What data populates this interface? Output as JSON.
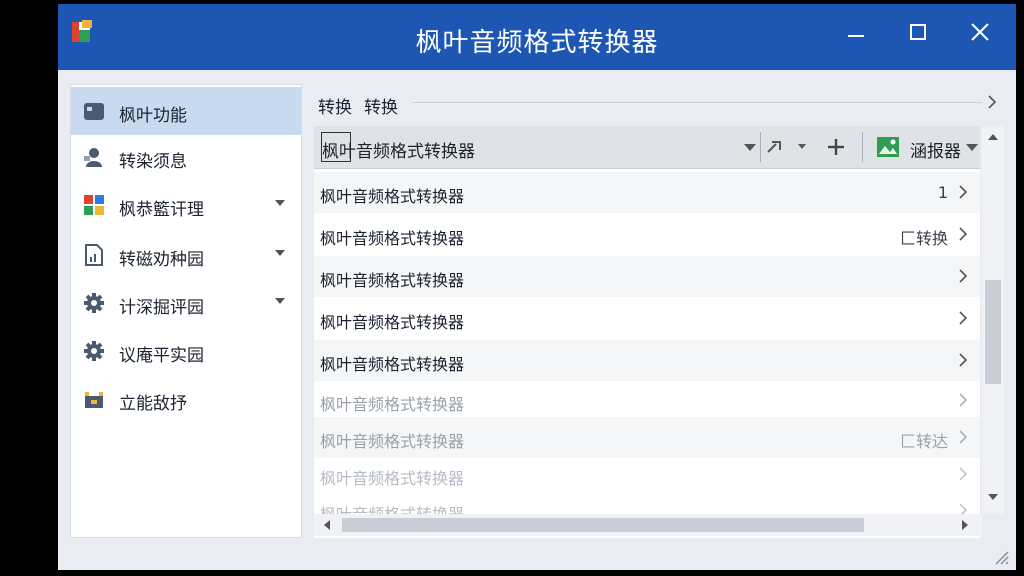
{
  "window": {
    "title": "枫叶音频格式转换器",
    "controls": [
      "minimize",
      "maximize",
      "close"
    ]
  },
  "sidebar": {
    "items": [
      {
        "label": "枫叶功能",
        "icon": "feature-panel-icon",
        "active": true,
        "expandable": false
      },
      {
        "label": "转染须息",
        "icon": "user-chat-icon",
        "active": false,
        "expandable": false
      },
      {
        "label": "枫恭籃讦理",
        "icon": "colored-tiles-icon",
        "active": false,
        "expandable": true
      },
      {
        "label": "转磁劝种园",
        "icon": "document-chart-icon",
        "active": false,
        "expandable": true
      },
      {
        "label": "计深掘评园",
        "icon": "gear-icon",
        "active": false,
        "expandable": true
      },
      {
        "label": "议庵平实园",
        "icon": "gear-icon",
        "active": false,
        "expandable": false
      },
      {
        "label": "立能敌抒",
        "icon": "toolbox-icon",
        "active": false,
        "expandable": false
      }
    ]
  },
  "breadcrumb": {
    "items": [
      "转换",
      "转换"
    ]
  },
  "toolbar": {
    "combo_value": "枫叶音频格式转换器",
    "right_button_label": "涵报器",
    "icons": [
      "dropdown-icon",
      "link-edit-icon",
      "add-icon",
      "image-icon"
    ]
  },
  "rows": [
    {
      "label": "枫叶音频格式转换器",
      "meta": "1"
    },
    {
      "label": "枫叶音频格式转换器",
      "meta": "匚转换"
    },
    {
      "label": "枫叶音频格式转换器",
      "meta": ""
    },
    {
      "label": "枫叶音频格式转换器",
      "meta": ""
    },
    {
      "label": "枫叶音频格式转换器",
      "meta": ""
    },
    {
      "label": "枫叶音频格式转换器",
      "meta": ""
    },
    {
      "label": "枫叶音频格式转换器",
      "meta": "匚转达"
    },
    {
      "label": "枫叶音频格式转换器",
      "meta": ""
    },
    {
      "label": "枫叶音频格式转换器",
      "meta": ""
    }
  ],
  "colors": {
    "titlebar": "#1d56b3",
    "sidebar_active": "#c7daef",
    "window_bg": "#e9edf3"
  }
}
